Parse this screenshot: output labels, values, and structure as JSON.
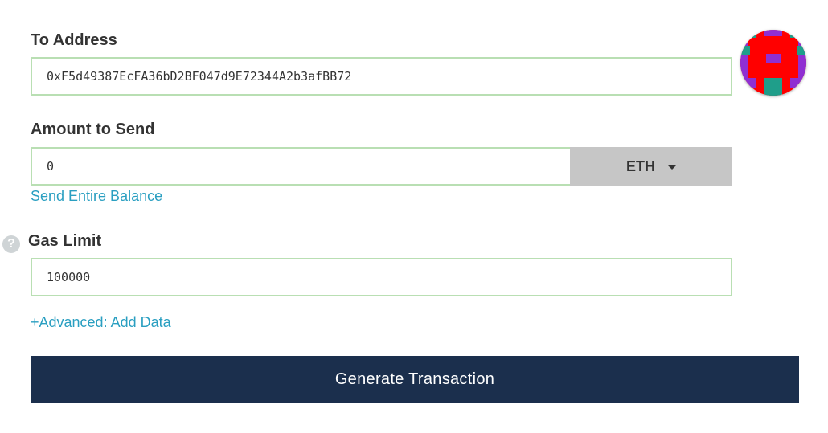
{
  "to_address": {
    "label": "To Address",
    "value": "0xF5d49387EcFA36bD2BF047d9E72344A2b3afBB72"
  },
  "amount": {
    "label": "Amount to Send",
    "value": "0",
    "unit": "ETH",
    "send_entire_balance": "Send Entire Balance"
  },
  "gas": {
    "help_icon": "?",
    "label": "Gas Limit",
    "value": "100000"
  },
  "advanced_link": "+Advanced: Add Data",
  "generate_button": "Generate Transaction",
  "icons": {
    "help": "question-circle-icon",
    "dropdown": "caret-down-icon",
    "identicon": "address-identicon"
  },
  "colors": {
    "field_border": "#b9dfb3",
    "link": "#2a9fc1",
    "button_bg": "#1b2f4d",
    "dropdown_bg": "#c6c6c6",
    "identicon_red": "#ff0000",
    "identicon_purple": "#8f2fd2",
    "identicon_teal": "#1f9e8a"
  }
}
